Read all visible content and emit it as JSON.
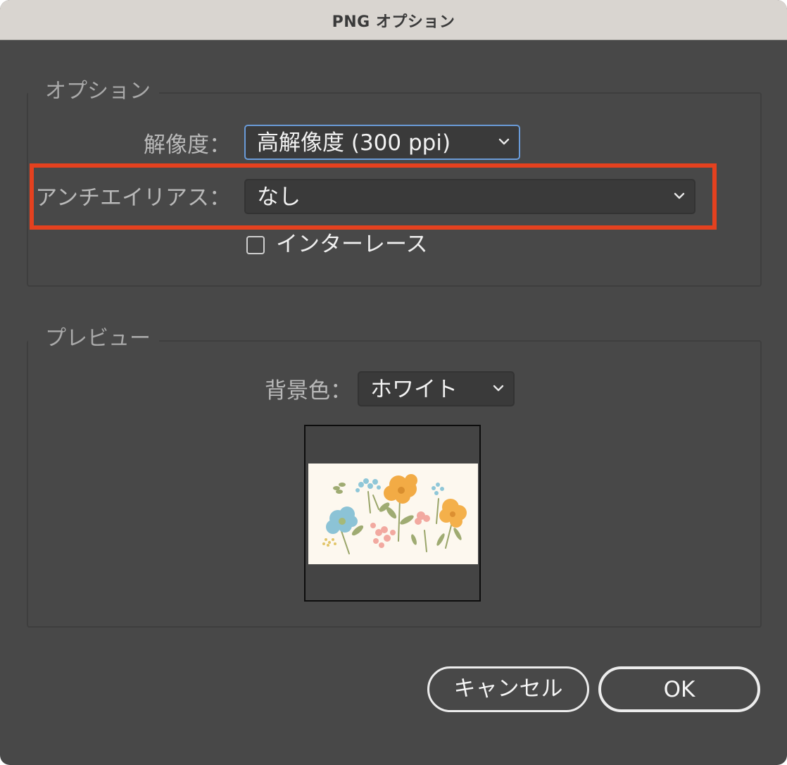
{
  "window": {
    "title": "PNG オプション"
  },
  "options": {
    "legend": "オプション",
    "resolution": {
      "label": "解像度：",
      "value": "高解像度 (300 ppi)"
    },
    "antialias": {
      "label": "アンチエイリアス：",
      "value": "なし"
    },
    "interlace": {
      "label": "インターレース",
      "checked": false
    }
  },
  "preview": {
    "legend": "プレビュー",
    "background": {
      "label": "背景色：",
      "value": "ホワイト"
    }
  },
  "buttons": {
    "cancel": "キャンセル",
    "ok": "OK"
  },
  "colors": {
    "dialog_bg": "#484848",
    "titlebar_bg": "#d9d5d0",
    "focus_border": "#6a9bd8",
    "highlight": "#e4411f"
  }
}
